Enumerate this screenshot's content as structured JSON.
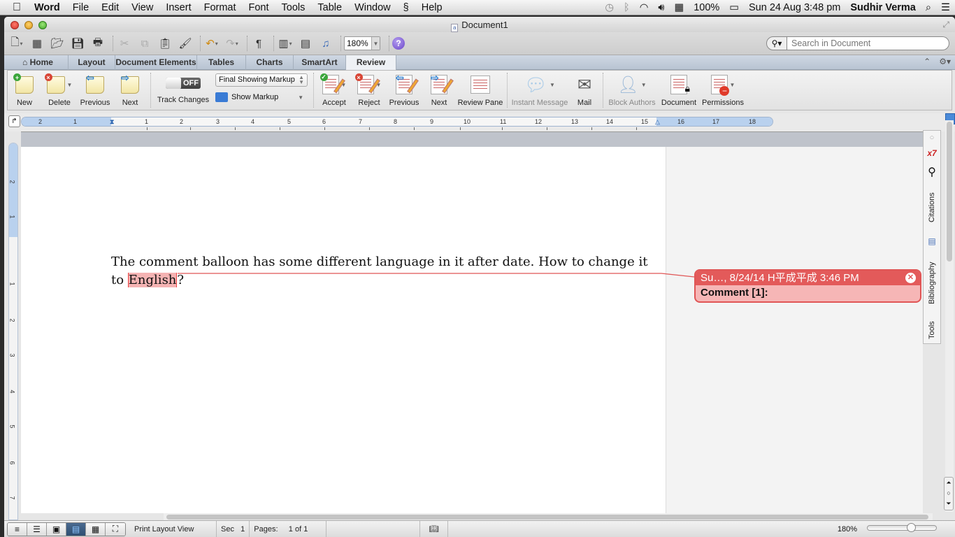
{
  "menubar": {
    "apple": "",
    "app": "Word",
    "items": [
      "File",
      "Edit",
      "View",
      "Insert",
      "Format",
      "Font",
      "Tools",
      "Table",
      "Window",
      "Help"
    ],
    "status": {
      "battery": "100%",
      "datetime": "Sun 24 Aug  3:48 pm",
      "user": "Sudhir Verma"
    }
  },
  "window": {
    "title": "Document1"
  },
  "toolbar": {
    "zoom": "180%",
    "search_placeholder": "Search in Document"
  },
  "ribbon_tabs": [
    "Home",
    "Layout",
    "Document Elements",
    "Tables",
    "Charts",
    "SmartArt",
    "Review"
  ],
  "active_tab": "Review",
  "ribbon": {
    "comments": [
      {
        "label": "New"
      },
      {
        "label": "Delete"
      },
      {
        "label": "Previous"
      },
      {
        "label": "Next"
      }
    ],
    "track_changes": {
      "toggle_state": "OFF",
      "label": "Track Changes",
      "markup_select": "Final Showing Markup",
      "show_markup": "Show Markup"
    },
    "changes": [
      {
        "label": "Accept"
      },
      {
        "label": "Reject"
      },
      {
        "label": "Previous"
      },
      {
        "label": "Next"
      },
      {
        "label": "Review Pane"
      }
    ],
    "share": [
      {
        "label": "Instant Message"
      },
      {
        "label": "Mail"
      }
    ],
    "protection": [
      {
        "label": "Block Authors"
      },
      {
        "label": "Document"
      },
      {
        "label": "Permissions"
      }
    ]
  },
  "ruler": {
    "h_left": [
      "2",
      "1"
    ],
    "h_right": [
      "1",
      "2",
      "3",
      "4",
      "5",
      "6",
      "7",
      "8",
      "9",
      "10",
      "11",
      "12",
      "13",
      "14",
      "15",
      "16",
      "17",
      "18"
    ],
    "v_top": [
      "2",
      "1"
    ],
    "v_bottom": [
      "1",
      "2",
      "3",
      "4",
      "5",
      "6",
      "7"
    ]
  },
  "document": {
    "text_before": "The comment balloon has some different language in it after date. How to change it to ",
    "highlighted": "English",
    "text_after": "?"
  },
  "comment_balloon": {
    "header": "Su…, 8/24/14 H平成平成 3:46 PM",
    "body": "Comment [1]:"
  },
  "toolbox": {
    "tabs": [
      "Citations",
      "Bibliography",
      "Tools"
    ]
  },
  "statusbar": {
    "view": "Print Layout View",
    "sec_label": "Sec",
    "sec_value": "1",
    "pages_label": "Pages:",
    "pages_value": "1 of 1",
    "zoom": "180%"
  }
}
